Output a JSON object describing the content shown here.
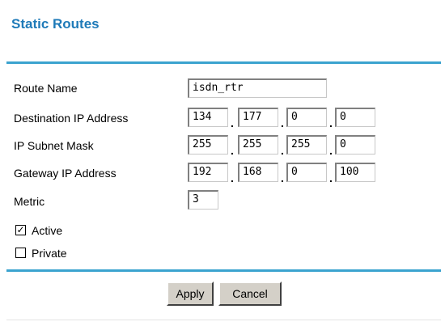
{
  "page": {
    "title": "Static Routes"
  },
  "colors": {
    "title": "#1e7ab8",
    "divider": "#3ba3cf"
  },
  "form": {
    "route_name": {
      "label": "Route Name",
      "value": "isdn_rtr"
    },
    "destination_ip": {
      "label": "Destination IP Address",
      "octets": [
        "134",
        "177",
        "0",
        "0"
      ]
    },
    "subnet_mask": {
      "label": "IP Subnet Mask",
      "octets": [
        "255",
        "255",
        "255",
        "0"
      ]
    },
    "gateway_ip": {
      "label": "Gateway IP Address",
      "octets": [
        "192",
        "168",
        "0",
        "100"
      ]
    },
    "metric": {
      "label": "Metric",
      "value": "3"
    },
    "active": {
      "label": "Active",
      "checked": true,
      "mark": "✓"
    },
    "private": {
      "label": "Private",
      "checked": false,
      "mark": ""
    }
  },
  "buttons": {
    "apply_label": "Apply",
    "cancel_label": "Cancel"
  }
}
